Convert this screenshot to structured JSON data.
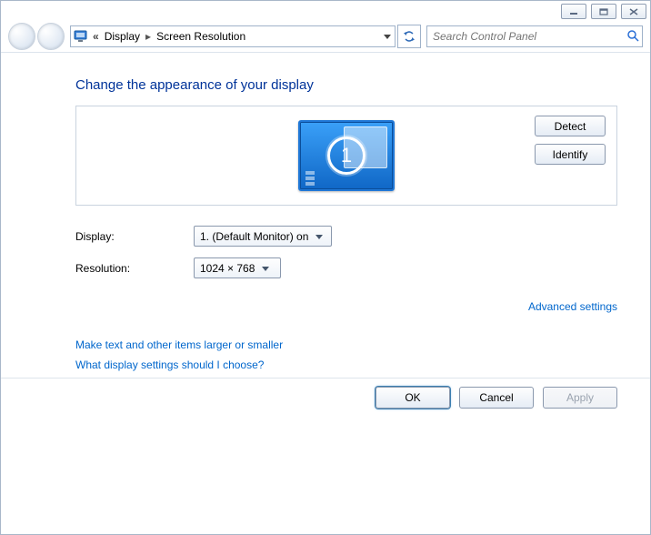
{
  "breadcrumb": [
    "Display",
    "Screen Resolution"
  ],
  "search": {
    "placeholder": "Search Control Panel"
  },
  "main": {
    "heading": "Change the appearance of your display",
    "monitor_number": "1",
    "buttons": {
      "detect": "Detect",
      "identify": "Identify"
    },
    "fields": {
      "display_label": "Display:",
      "display_value": "1. (Default Monitor) on",
      "resolution_label": "Resolution:",
      "resolution_value": "1024 × 768"
    },
    "links": {
      "advanced": "Advanced settings",
      "text_size": "Make text and other items larger or smaller",
      "help": "What display settings should I choose?"
    }
  },
  "footer": {
    "ok": "OK",
    "cancel": "Cancel",
    "apply": "Apply"
  }
}
